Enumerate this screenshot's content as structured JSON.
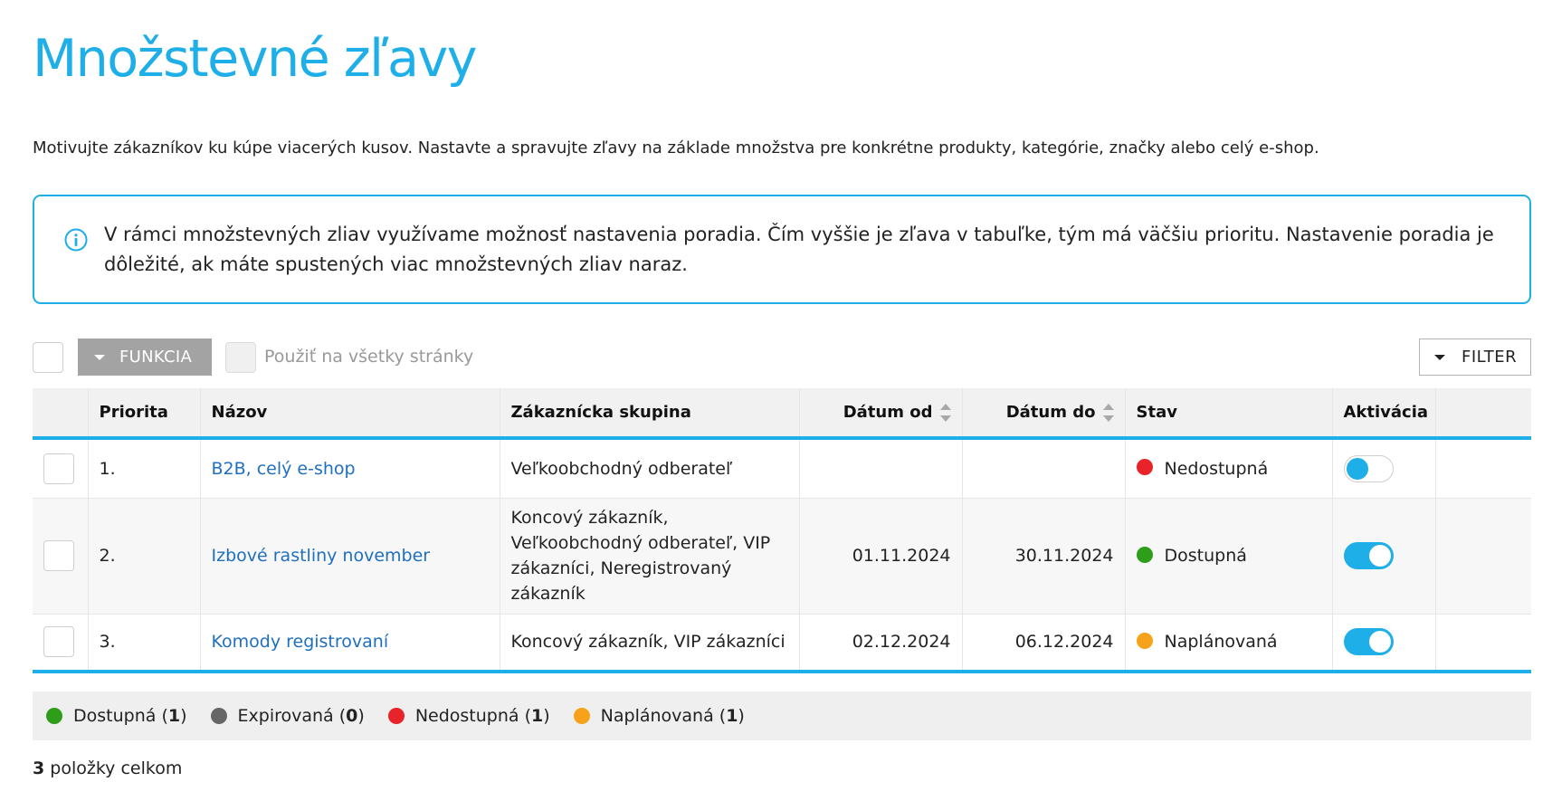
{
  "page": {
    "title": "Množstevné zľavy",
    "intro": "Motivujte zákazníkov ku kúpe viacerých kusov. Nastavte a spravujte zľavy na základe množstva pre konkrétne produkty, kategórie, značky alebo celý e-shop."
  },
  "info": {
    "icon": "info-icon",
    "text": "V rámci množstevných zliav využívame možnosť nastavenia poradia. Čím vyššie je zľava v tabuľke, tým má väčšiu prioritu. Nastavenie poradia je dôležité, ak máte spustených viac množstevných zliav naraz."
  },
  "toolbar": {
    "funkcia_label": "FUNKCIA",
    "apply_all_label": "Použiť na všetky stránky",
    "filter_label": "FILTER"
  },
  "table": {
    "columns": {
      "priority": "Priorita",
      "name": "Názov",
      "group": "Zákaznícka skupina",
      "date_from": "Dátum od",
      "date_to": "Dátum do",
      "status": "Stav",
      "activation": "Aktivácia"
    },
    "rows": [
      {
        "priority": "1.",
        "name": "B2B, celý e-shop",
        "group": "Veľkoobchodný odberateľ",
        "date_from": "",
        "date_to": "",
        "status": "Nedostupná",
        "status_color": "#e8232a",
        "active": false
      },
      {
        "priority": "2.",
        "name": "Izbové rastliny november",
        "group": "Koncový zákazník, Veľkoobchodný odberateľ, VIP zákazníci, Neregistrovaný zákazník",
        "date_from": "01.11.2024",
        "date_to": "30.11.2024",
        "status": "Dostupná",
        "status_color": "#2e9e1a",
        "active": true
      },
      {
        "priority": "3.",
        "name": "Komody registrovaní",
        "group": "Koncový zákazník, VIP zákazníci",
        "date_from": "02.12.2024",
        "date_to": "06.12.2024",
        "status": "Naplánovaná",
        "status_color": "#f7a21b",
        "active": true
      }
    ]
  },
  "legend": [
    {
      "label": "Dostupná",
      "count": "1",
      "color": "#2e9e1a"
    },
    {
      "label": "Expirovaná",
      "count": "0",
      "color": "#666666"
    },
    {
      "label": "Nedostupná",
      "count": "1",
      "color": "#e8232a"
    },
    {
      "label": "Naplánovaná",
      "count": "1",
      "color": "#f7a21b"
    }
  ],
  "footer": {
    "total_count": "3",
    "total_label": "položky celkom"
  },
  "colors": {
    "accent": "#1eaee8",
    "link": "#1f6fbf"
  }
}
